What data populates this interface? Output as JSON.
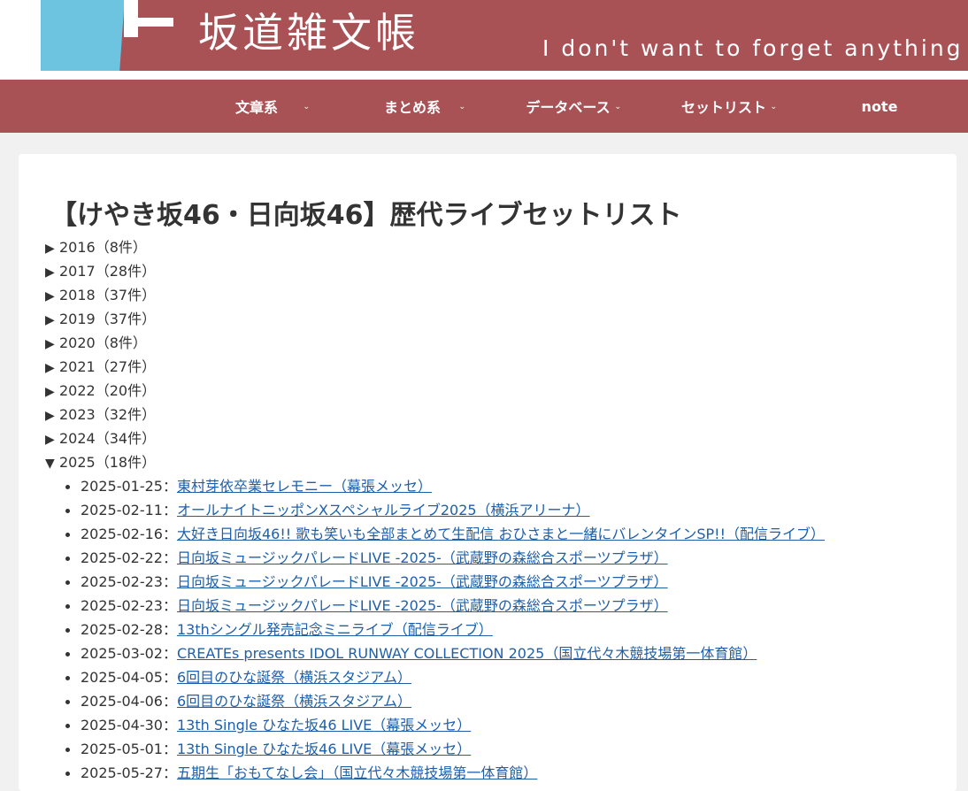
{
  "header": {
    "site_title": "坂道雑文帳",
    "tagline": "I don't want to forget anything if"
  },
  "nav": {
    "items": [
      {
        "label": "文章系"
      },
      {
        "label": "まとめ系"
      },
      {
        "label": "データベース"
      },
      {
        "label": "セットリスト"
      },
      {
        "label": "note"
      }
    ],
    "chevron": "⌄"
  },
  "main": {
    "title": "【けやき坂46・日向坂46】歴代ライブセットリスト",
    "collapsed_marker": "▶",
    "expanded_marker": "▼",
    "separator": "：",
    "years": [
      {
        "label": "2016（8件）"
      },
      {
        "label": "2017（28件）"
      },
      {
        "label": "2018（37件）"
      },
      {
        "label": "2019（37件）"
      },
      {
        "label": "2020（8件）"
      },
      {
        "label": "2021（27件）"
      },
      {
        "label": "2022（20件）"
      },
      {
        "label": "2023（32件）"
      },
      {
        "label": "2024（34件）"
      },
      {
        "label": "2025（18件）"
      }
    ],
    "events_2025": [
      {
        "date": "2025-01-25",
        "title": "東村芽依卒業セレモニー（幕張メッセ）"
      },
      {
        "date": "2025-02-11",
        "title": "オールナイトニッポンXスペシャルライブ2025（横浜アリーナ）"
      },
      {
        "date": "2025-02-16",
        "title": "大好き日向坂46!! 歌も笑いも全部まとめて生配信 おひさまと一緒にバレンタインSP!!（配信ライブ）"
      },
      {
        "date": "2025-02-22",
        "title": "日向坂ミュージックパレードLIVE -2025-（武蔵野の森総合スポーツプラザ）"
      },
      {
        "date": "2025-02-23",
        "title": "日向坂ミュージックパレードLIVE -2025-（武蔵野の森総合スポーツプラザ）"
      },
      {
        "date": "2025-02-23",
        "title": "日向坂ミュージックパレードLIVE -2025-（武蔵野の森総合スポーツプラザ）"
      },
      {
        "date": "2025-02-28",
        "title": "13thシングル発売記念ミニライブ（配信ライブ）"
      },
      {
        "date": "2025-03-02",
        "title": "CREATEs presents IDOL RUNWAY COLLECTION 2025（国立代々木競技場第一体育館）"
      },
      {
        "date": "2025-04-05",
        "title": "6回目のひな誕祭（横浜スタジアム）"
      },
      {
        "date": "2025-04-06",
        "title": "6回目のひな誕祭（横浜スタジアム）"
      },
      {
        "date": "2025-04-30",
        "title": "13th Single ひなた坂46 LIVE（幕張メッセ）"
      },
      {
        "date": "2025-05-01",
        "title": "13th Single ひなた坂46 LIVE（幕張メッセ）"
      },
      {
        "date": "2025-05-27",
        "title": "五期生「おもてなし会」（国立代々木競技場第一体育館）"
      }
    ]
  },
  "colors": {
    "brand": "#a85256",
    "accent_blue": "#6cc4e0",
    "link": "#1f5fa8",
    "background": "#f1f1f1"
  }
}
